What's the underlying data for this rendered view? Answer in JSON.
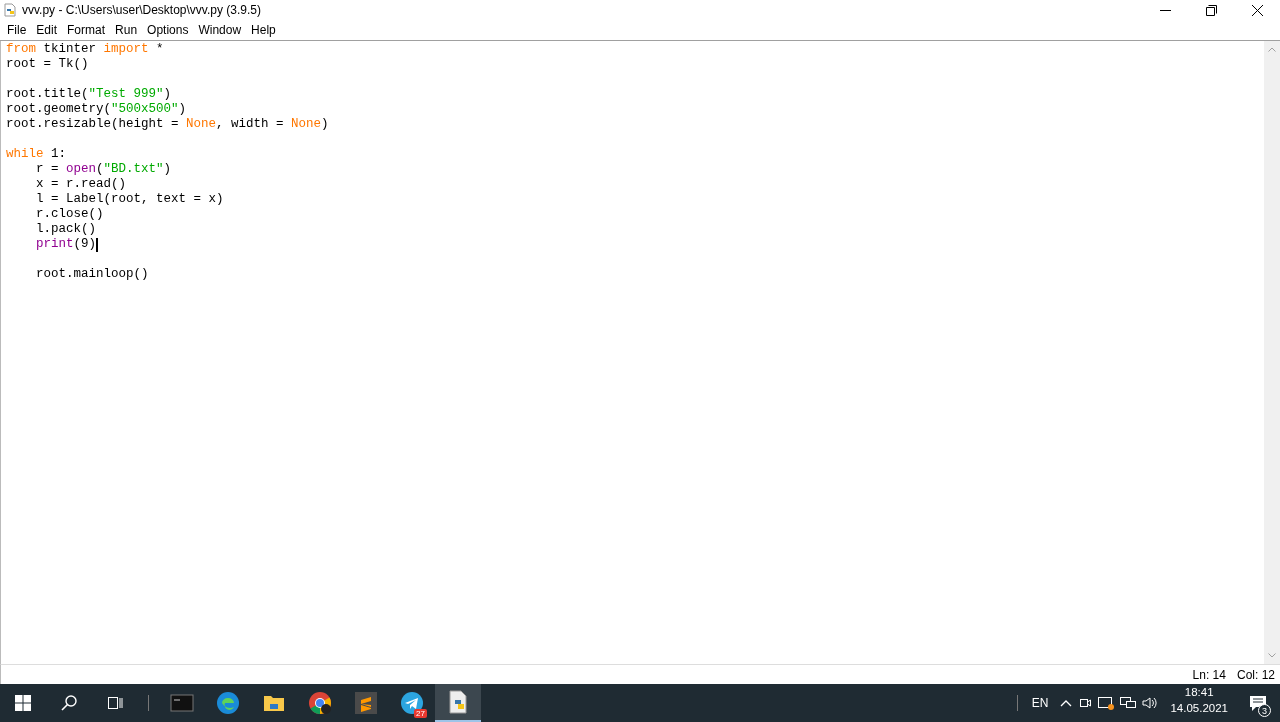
{
  "window": {
    "title": "vvv.py - C:\\Users\\user\\Desktop\\vvv.py (3.9.5)"
  },
  "menu": [
    "File",
    "Edit",
    "Format",
    "Run",
    "Options",
    "Window",
    "Help"
  ],
  "editor": {
    "lines": [
      {
        "kind": "code",
        "indented": false,
        "cursor": false,
        "tokens": [
          {
            "t": "from",
            "kind": "keyword"
          },
          {
            "t": " tkinter ",
            "kind": "plain"
          },
          {
            "t": "import",
            "kind": "keyword"
          },
          {
            "t": " *",
            "kind": "plain"
          }
        ]
      },
      {
        "kind": "code",
        "indented": false,
        "cursor": false,
        "tokens": [
          {
            "t": "root = Tk()",
            "kind": "plain"
          }
        ]
      },
      {
        "kind": "blank",
        "cursor": false
      },
      {
        "kind": "code",
        "indented": false,
        "cursor": false,
        "tokens": [
          {
            "t": "root.title(",
            "kind": "plain"
          },
          {
            "t": "\"Test 999\"",
            "kind": "string"
          },
          {
            "t": ")",
            "kind": "plain"
          }
        ]
      },
      {
        "kind": "code",
        "indented": false,
        "cursor": false,
        "tokens": [
          {
            "t": "root.geometry(",
            "kind": "plain"
          },
          {
            "t": "\"500x500\"",
            "kind": "string"
          },
          {
            "t": ")",
            "kind": "plain"
          }
        ]
      },
      {
        "kind": "code",
        "indented": false,
        "cursor": false,
        "tokens": [
          {
            "t": "root.resizable(height = ",
            "kind": "plain"
          },
          {
            "t": "None",
            "kind": "keyword"
          },
          {
            "t": ", width = ",
            "kind": "plain"
          },
          {
            "t": "None",
            "kind": "keyword"
          },
          {
            "t": ")",
            "kind": "plain"
          }
        ]
      },
      {
        "kind": "blank",
        "cursor": false
      },
      {
        "kind": "code",
        "indented": false,
        "cursor": false,
        "tokens": [
          {
            "t": "while",
            "kind": "keyword"
          },
          {
            "t": " 1:",
            "kind": "plain"
          }
        ]
      },
      {
        "kind": "code",
        "indented": true,
        "cursor": false,
        "tokens": [
          {
            "t": "r = ",
            "kind": "plain"
          },
          {
            "t": "open",
            "kind": "builtin"
          },
          {
            "t": "(",
            "kind": "plain"
          },
          {
            "t": "\"BD.txt\"",
            "kind": "string"
          },
          {
            "t": ")",
            "kind": "plain"
          }
        ]
      },
      {
        "kind": "code",
        "indented": true,
        "cursor": false,
        "tokens": [
          {
            "t": "x = r.read()",
            "kind": "plain"
          }
        ]
      },
      {
        "kind": "code",
        "indented": true,
        "cursor": false,
        "tokens": [
          {
            "t": "l = Label(root, text = x)",
            "kind": "plain"
          }
        ]
      },
      {
        "kind": "code",
        "indented": true,
        "cursor": false,
        "tokens": [
          {
            "t": "r.close()",
            "kind": "plain"
          }
        ]
      },
      {
        "kind": "code",
        "indented": true,
        "cursor": false,
        "tokens": [
          {
            "t": "l.pack()",
            "kind": "plain"
          }
        ]
      },
      {
        "kind": "code",
        "indented": true,
        "cursor": true,
        "tokens": [
          {
            "t": "print",
            "kind": "builtin"
          },
          {
            "t": "(9)",
            "kind": "plain"
          }
        ]
      },
      {
        "kind": "blank",
        "cursor": false
      },
      {
        "kind": "code",
        "indented": true,
        "cursor": false,
        "tokens": [
          {
            "t": "root.mainloop()",
            "kind": "plain"
          }
        ]
      }
    ]
  },
  "status_bar": {
    "line": "Ln: 14",
    "column": "Col: 12"
  },
  "taskbar": {
    "apps": [
      {
        "kind": "terminal",
        "selected": false
      },
      {
        "kind": "edge",
        "selected": false
      },
      {
        "kind": "folder",
        "selected": false
      },
      {
        "kind": "chrome",
        "selected": false
      },
      {
        "kind": "sublime",
        "selected": false
      },
      {
        "kind": "telegram",
        "selected": false,
        "badge": "27"
      },
      {
        "kind": "python",
        "selected": true
      }
    ],
    "language": "EN",
    "time": "18:41",
    "date": "14.05.2021",
    "notifications": "3"
  }
}
